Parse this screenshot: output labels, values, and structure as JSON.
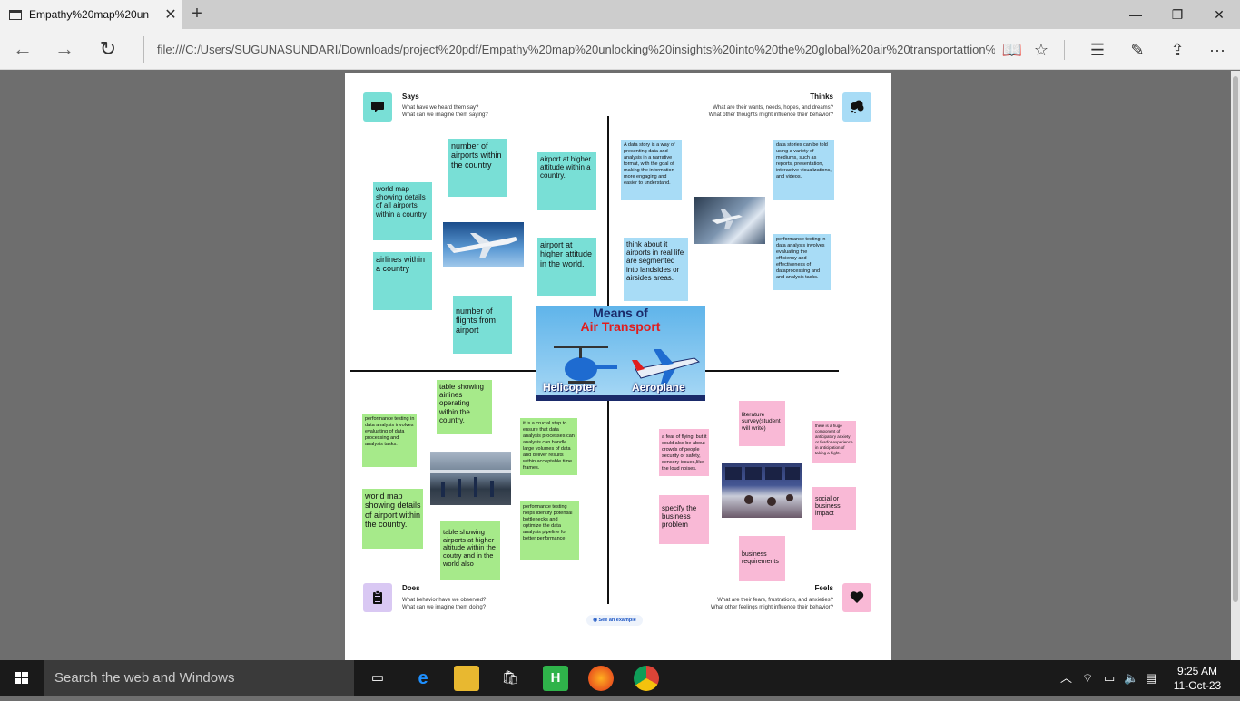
{
  "browser": {
    "tab_title": "Empathy%20map%20un",
    "tab_close": "✕",
    "new_tab": "+",
    "address": "file:///C:/Users/SUGUNASUNDARI/Downloads/project%20pdf/Empathy%20map%20unlocking%20insights%20into%20the%20global%20air%20transportattion%",
    "minimize": "—",
    "maximize": "❐",
    "close": "✕",
    "back": "←",
    "forward": "→",
    "refresh": "↻",
    "reading": "📖",
    "favorite": "☆",
    "hub": "☰",
    "note": "✎",
    "share": "⇪",
    "more": "···"
  },
  "empathy_map": {
    "says": {
      "title": "Says",
      "sub1": "What have we heard them say?",
      "sub2": "What can we imagine them saying?",
      "notes": [
        "number of airports within  the country",
        "airport at higher attitude within a country.",
        "world map showing details of all airports within a country",
        "airlines within a country",
        "airport at higher attitude in the world.",
        "number of flights from airport"
      ]
    },
    "thinks": {
      "title": "Thinks",
      "sub1": "What are their wants, needs, hopes, and dreams?",
      "sub2": "What other thoughts might influence their behavior?",
      "notes": [
        "A data story is a way of presenting data and analysis in a narrative format, with the goal of making the information more engaging and easier to understand.",
        "data stories can be told using a variety of mediums, such as reports, presentation, interactive visualizations, and videos.",
        "think about it airports in real life are segmented into landsides or airsides areas.",
        "performance testing in data analysis involves evaluating the efficiency  and effectiveness of dataprocessing and and analysis tasks."
      ]
    },
    "does": {
      "title": "Does",
      "sub1": "What behavior have we observed?",
      "sub2": "What can we imagine them doing?",
      "notes": [
        "table showing airlines operating within the country.",
        "performance testing in data analysis involves evaluating of data processing and analysis tasks.",
        "it is a crucial step to ensure that data analysis processes can analysis can handle large volumes of data and deliver results within acceptable time frames.",
        "world map showing details of airport within the country.",
        "table showing airports at higher altitude within the coutry and in the world also",
        "performance testing helps identify potential bottlenecks and optimize the data analysis pipeline for better performance."
      ]
    },
    "feels": {
      "title": "Feels",
      "sub1": "What are their fears, frustrations, and anxieties?",
      "sub2": "What other feelings might influence their behavior?",
      "notes": [
        "literature survey(student will write)",
        "there is a huge component of anticipatory anxiety or fearfor experience in anticipation of taking a flight.",
        "a fear of flying, but it could also be about crowds of people security or safety, sensory issues,like the loud noises.",
        "specify the business problem",
        "social or business impact",
        "business requirements"
      ]
    },
    "center_image": {
      "title_line1": "Means of",
      "title_line2": "Air Transport",
      "label_left": "Helicopter",
      "label_right": "Aeroplane"
    },
    "see_example": "See an example"
  },
  "colors": {
    "cyan": "#79dfd6",
    "blue": "#a8dcf6",
    "green": "#a6ea8a",
    "pink": "#f9b9d6",
    "says_icon_bg": "#79dfd6",
    "thinks_icon_bg": "#a8dcf6",
    "does_icon_bg": "#d9c8f3",
    "feels_icon_bg": "#f9b9d6"
  },
  "taskbar": {
    "search_placeholder": "Search the web and Windows",
    "time": "9:25 AM",
    "date": "11-Oct-23"
  }
}
